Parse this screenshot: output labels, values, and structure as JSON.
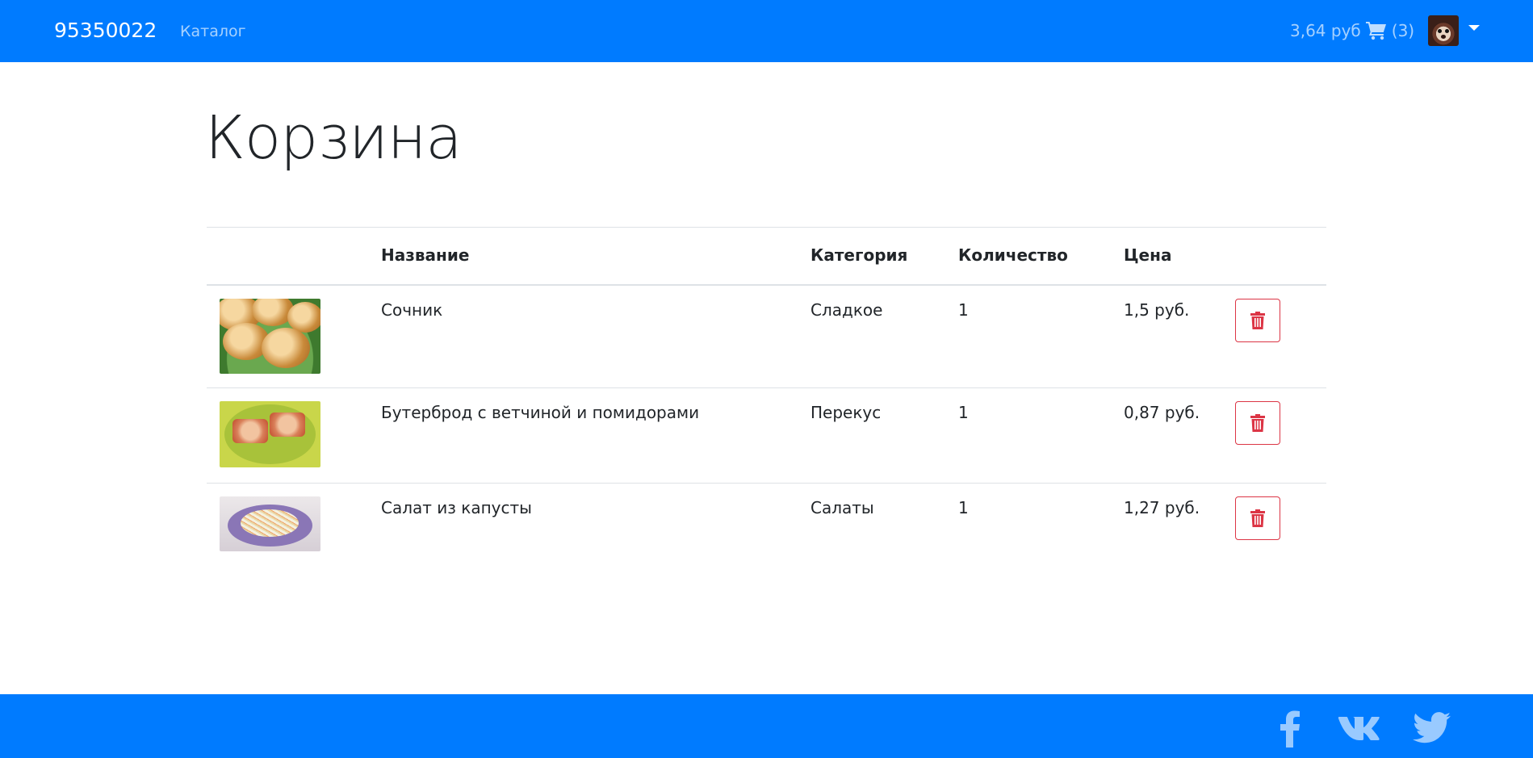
{
  "navbar": {
    "brand": "95350022",
    "catalog_link": "Каталог",
    "cart_total": "3,64 руб",
    "cart_count": "(3)",
    "icons": {
      "cart": "cart-icon",
      "avatar": "avatar",
      "caret": "chevron-down-icon"
    }
  },
  "page": {
    "title": "Корзина"
  },
  "table": {
    "headers": {
      "image": "",
      "name": "Название",
      "category": "Категория",
      "quantity": "Количество",
      "price": "Цена",
      "actions": ""
    },
    "rows": [
      {
        "name": "Сочник",
        "category": "Сладкое",
        "quantity": "1",
        "price": "1,5 руб.",
        "image_icon": "food-thumbnail",
        "delete_icon": "trash-icon"
      },
      {
        "name": "Бутерброд с ветчиной и помидорами",
        "category": "Перекус",
        "quantity": "1",
        "price": "0,87 руб.",
        "image_icon": "food-thumbnail",
        "delete_icon": "trash-icon"
      },
      {
        "name": "Салат из капусты",
        "category": "Салаты",
        "quantity": "1",
        "price": "1,27 руб.",
        "image_icon": "food-thumbnail",
        "delete_icon": "trash-icon"
      }
    ]
  },
  "footer": {
    "social": [
      "facebook-icon",
      "vk-icon",
      "twitter-icon"
    ]
  },
  "colors": {
    "primary": "#007bff",
    "danger": "#dc3545",
    "text": "#212529",
    "border": "#dee2e6"
  }
}
